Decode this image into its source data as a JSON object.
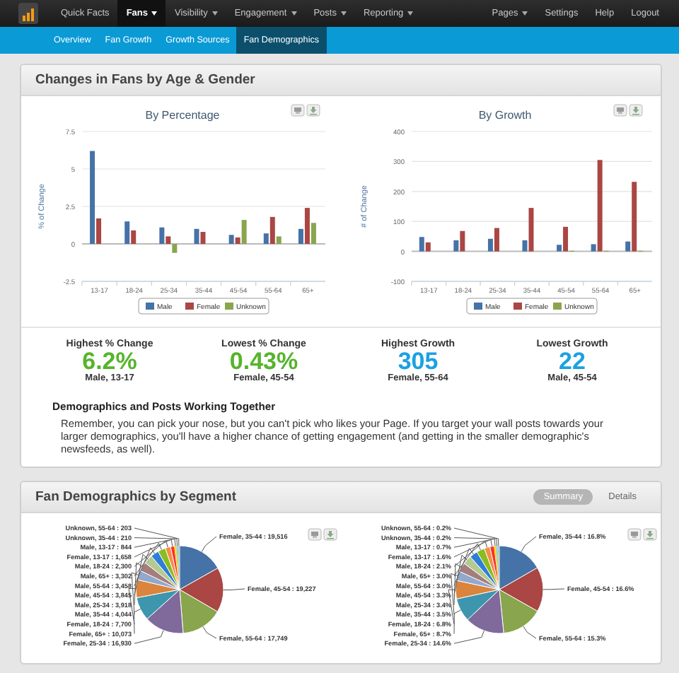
{
  "nav": {
    "left": [
      {
        "label": "Quick Facts",
        "dropdown": false,
        "selected": false
      },
      {
        "label": "Fans",
        "dropdown": true,
        "selected": true
      },
      {
        "label": "Visibility",
        "dropdown": true,
        "selected": false
      },
      {
        "label": "Engagement",
        "dropdown": true,
        "selected": false
      },
      {
        "label": "Posts",
        "dropdown": true,
        "selected": false
      },
      {
        "label": "Reporting",
        "dropdown": true,
        "selected": false
      }
    ],
    "right": [
      {
        "label": "Pages",
        "dropdown": true,
        "selected": false
      },
      {
        "label": "Settings",
        "dropdown": false,
        "selected": false
      },
      {
        "label": "Help",
        "dropdown": false,
        "selected": false
      },
      {
        "label": "Logout",
        "dropdown": false,
        "selected": false
      }
    ]
  },
  "subnav": {
    "items": [
      {
        "label": "Overview",
        "selected": false
      },
      {
        "label": "Fan Growth",
        "selected": false
      },
      {
        "label": "Growth Sources",
        "selected": false
      },
      {
        "label": "Fan Demographics",
        "selected": true
      }
    ]
  },
  "changes_panel": {
    "title": "Changes in Fans by Age & Gender",
    "charts": [
      {
        "chart_data": {
          "type": "bar",
          "title": "By Percentage",
          "ylabel": "% of Change",
          "categories": [
            "13-17",
            "18-24",
            "25-34",
            "35-44",
            "45-54",
            "55-64",
            "65+"
          ],
          "series": [
            {
              "name": "Male",
              "color": "#4572a7",
              "values": [
                6.2,
                1.5,
                1.1,
                1.0,
                0.6,
                0.7,
                1.0
              ]
            },
            {
              "name": "Female",
              "color": "#aa4643",
              "values": [
                1.7,
                0.9,
                0.5,
                0.8,
                0.43,
                1.8,
                2.4
              ]
            },
            {
              "name": "Unknown",
              "color": "#89a54e",
              "values": [
                null,
                null,
                -0.6,
                null,
                1.6,
                0.5,
                1.4
              ]
            }
          ],
          "ylim": [
            -2.5,
            7.5
          ],
          "yticks": [
            -2.5,
            0,
            2.5,
            5,
            7.5
          ],
          "grid": true,
          "legend": true
        }
      },
      {
        "chart_data": {
          "type": "bar",
          "title": "By Growth",
          "ylabel": "# of Change",
          "categories": [
            "13-17",
            "18-24",
            "25-34",
            "35-44",
            "45-54",
            "55-64",
            "65+"
          ],
          "series": [
            {
              "name": "Male",
              "color": "#4572a7",
              "values": [
                48,
                37,
                42,
                37,
                22,
                24,
                33
              ]
            },
            {
              "name": "Female",
              "color": "#aa4643",
              "values": [
                30,
                68,
                78,
                145,
                82,
                305,
                232
              ]
            },
            {
              "name": "Unknown",
              "color": "#89a54e",
              "values": [
                null,
                null,
                null,
                null,
                2,
                2,
                2
              ]
            }
          ],
          "ylim": [
            -100,
            400
          ],
          "yticks": [
            -100,
            0,
            100,
            200,
            300,
            400
          ],
          "grid": true,
          "legend": true
        }
      }
    ],
    "stats": [
      {
        "label": "Highest % Change",
        "value": "6.2%",
        "detail": "Male, 13-17",
        "kind": "percent"
      },
      {
        "label": "Lowest % Change",
        "value": "0.43%",
        "detail": "Female, 45-54",
        "kind": "percent"
      },
      {
        "label": "Highest Growth",
        "value": "305",
        "detail": "Female, 55-64",
        "kind": "growth"
      },
      {
        "label": "Lowest Growth",
        "value": "22",
        "detail": "Male, 45-54",
        "kind": "growth"
      }
    ],
    "tip": {
      "heading": "Demographics and Posts Working Together",
      "text": "Remember, you can pick your nose, but you can't pick who likes your Page. If you target your wall posts towards your larger demographics, you'll have a higher chance of getting engagement (and getting in the smaller demographic's newsfeeds, as well)."
    }
  },
  "segment_panel": {
    "title": "Fan Demographics by Segment",
    "toggle": [
      {
        "label": "Summary",
        "selected": true
      },
      {
        "label": "Details",
        "selected": false
      }
    ],
    "charts": [
      {
        "chart_data": {
          "type": "pie",
          "values": [
            19516,
            19227,
            17749,
            16930,
            10073,
            7700,
            4044,
            3918,
            3845,
            3458,
            3302,
            2300,
            1658,
            844,
            210,
            203
          ],
          "value_labels": [
            "Female, 35-44 : 19,516",
            "Female, 45-54 : 19,227",
            "Female, 55-64 : 17,749",
            "Female, 25-34 : 16,930",
            "Female, 65+ : 10,073",
            "Female, 18-24 : 7,700",
            "Male, 35-44 : 4,044",
            "Male, 25-34 : 3,918",
            "Male, 45-54 : 3,845",
            "Male, 55-64 : 3,458",
            "Male, 65+ : 3,302",
            "Male, 18-24 : 2,300",
            "Female, 13-17 : 1,658",
            "Male, 13-17 : 844",
            "Unknown, 35-44 : 210",
            "Unknown, 55-64 : 203"
          ]
        }
      },
      {
        "chart_data": {
          "type": "pie",
          "values": [
            16.8,
            16.6,
            15.3,
            14.6,
            8.7,
            6.8,
            3.5,
            3.4,
            3.3,
            3.0,
            3.0,
            2.1,
            1.6,
            0.7,
            0.2,
            0.2
          ],
          "value_labels": [
            "Female, 35-44 : 16.8%",
            "Female, 45-54 : 16.6%",
            "Female, 55-64 : 15.3%",
            "Female, 25-34 : 14.6%",
            "Female, 65+ : 8.7%",
            "Female, 18-24 : 6.8%",
            "Male, 35-44 : 3.5%",
            "Male, 25-34 : 3.4%",
            "Male, 45-54 : 3.3%",
            "Male, 55-64 : 3.0%",
            "Male, 65+ : 3.0%",
            "Male, 18-24 : 2.1%",
            "Female, 13-17 : 1.6%",
            "Male, 13-17 : 0.7%",
            "Unknown, 35-44 : 0.2%",
            "Unknown, 55-64 : 0.2%"
          ]
        }
      }
    ]
  }
}
